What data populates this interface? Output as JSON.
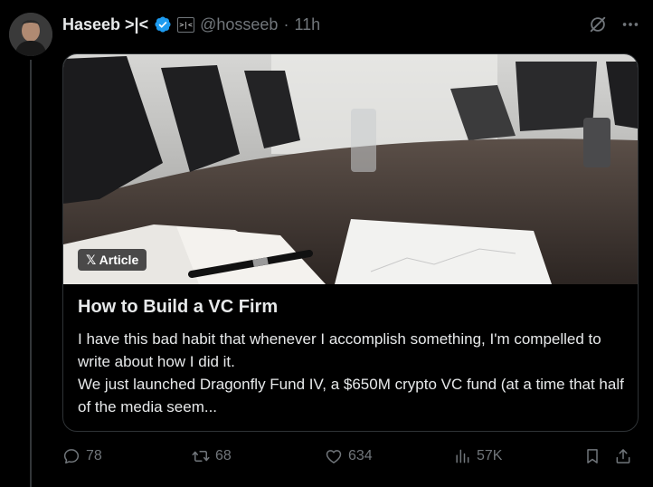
{
  "tweet": {
    "author_name": "Haseeb >|<",
    "affiliation_badge": ">|<",
    "handle": "@hosseeb",
    "separator": "·",
    "time": "11h"
  },
  "article": {
    "badge_label": "Article",
    "title": "How to Build a VC Firm",
    "paragraphs": [
      "I have this bad habit that whenever I accomplish something, I'm compelled to write about how I did it.",
      "We just launched Dragonfly Fund IV, a $650M crypto VC fund (at a time that half of the media seem..."
    ]
  },
  "actions": {
    "replies": "78",
    "reposts": "68",
    "likes": "634",
    "views": "57K"
  },
  "icons": {
    "verified": "verified-badge-icon",
    "grok": "grok-icon",
    "more": "more-icon",
    "reply": "reply-icon",
    "repost": "repost-icon",
    "like": "heart-icon",
    "views": "views-icon",
    "bookmark": "bookmark-icon",
    "share": "share-icon"
  },
  "colors": {
    "background": "#000000",
    "text": "#e7e9ea",
    "muted": "#71767b",
    "verified": "#1d9bf0",
    "border": "#2f3336"
  }
}
